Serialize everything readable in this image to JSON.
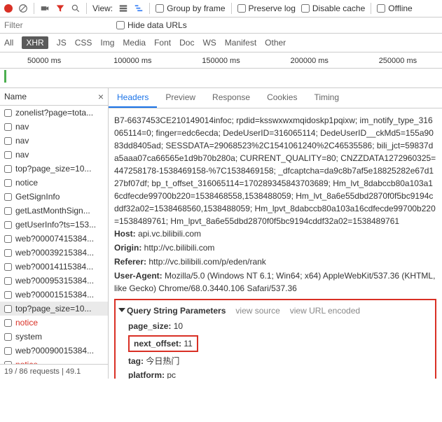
{
  "toolbar": {
    "view_label": "View:",
    "group_by_frame": "Group by frame",
    "preserve_log": "Preserve log",
    "disable_cache": "Disable cache",
    "offline": "Offline"
  },
  "filterbar": {
    "filter_placeholder": "Filter",
    "hide_data_urls": "Hide data URLs"
  },
  "filter_types": [
    "All",
    "XHR",
    "JS",
    "CSS",
    "Img",
    "Media",
    "Font",
    "Doc",
    "WS",
    "Manifest",
    "Other"
  ],
  "filter_active": "XHR",
  "timeline_ticks": [
    "50000 ms",
    "100000 ms",
    "150000 ms",
    "200000 ms",
    "250000 ms"
  ],
  "left": {
    "header": "Name",
    "close": "×",
    "rows": [
      {
        "label": "zonelist?page=tota..."
      },
      {
        "label": "nav"
      },
      {
        "label": "nav"
      },
      {
        "label": "nav"
      },
      {
        "label": "top?page_size=10..."
      },
      {
        "label": "notice"
      },
      {
        "label": "GetSignInfo"
      },
      {
        "label": "getLastMonthSign..."
      },
      {
        "label": "getUserInfo?ts=153..."
      },
      {
        "label": "web?00007415384..."
      },
      {
        "label": "web?00039215384..."
      },
      {
        "label": "web?00014115384..."
      },
      {
        "label": "web?00095315384..."
      },
      {
        "label": "web?00001515384..."
      },
      {
        "label": "top?page_size=10...",
        "selected": true
      },
      {
        "label": "notice",
        "red": true
      },
      {
        "label": "system"
      },
      {
        "label": "web?00090015384..."
      },
      {
        "label": "notice",
        "red": true
      }
    ],
    "footer": "19 / 86 requests | 49.1"
  },
  "tabs": [
    "Headers",
    "Preview",
    "Response",
    "Cookies",
    "Timing"
  ],
  "tab_active": "Headers",
  "cookie_blob": "B7-6637453CE210149014infoc; rpdid=ksswxwxmqidoskp1pqixw; im_notify_type_316065114=0; finger=edc6ecda; DedeUserID=316065114; DedeUserID__ckMd5=155a9083dd8405ad; SESSDATA=29068523%2C1541061240%2C46535586; bili_jct=59837da5aaa07ca66565e1d9b70b280a; CURRENT_QUALITY=80; CNZZDATA1272960325=447258178-1538469158-%7C1538469158; _dfcaptcha=da9c8b7af5e18825282e67d127bf07df; bp_t_offset_316065114=170289345843703689; Hm_lvt_8dabccb80a103a16cdfecde99700b220=1538468558,1538488059; Hm_lvt_8a6e55dbd2870f0f5bc9194cddf32a02=1538468560,1538488059; Hm_lpvt_8dabccb80a103a16cdfecde99700b220=1538489761; Hm_lpvt_8a6e55dbd2870f0f5bc9194cddf32a02=1538489761",
  "headers": {
    "host_k": "Host:",
    "host_v": "api.vc.bilibili.com",
    "origin_k": "Origin:",
    "origin_v": "http://vc.bilibili.com",
    "referer_k": "Referer:",
    "referer_v": "http://vc.bilibili.com/p/eden/rank",
    "ua_k": "User-Agent:",
    "ua_v": "Mozilla/5.0 (Windows NT 6.1; Win64; x64) AppleWebKit/537.36 (KHTML, like Gecko) Chrome/68.0.3440.106 Safari/537.36"
  },
  "query": {
    "section_title": "Query String Parameters",
    "view_source": "view source",
    "view_url_encoded": "view URL encoded",
    "params": [
      {
        "k": "page_size:",
        "v": "10"
      },
      {
        "k": "next_offset:",
        "v": "11",
        "boxed": true
      },
      {
        "k": "tag:",
        "v": "今日热门"
      },
      {
        "k": "platform:",
        "v": "pc"
      }
    ]
  }
}
